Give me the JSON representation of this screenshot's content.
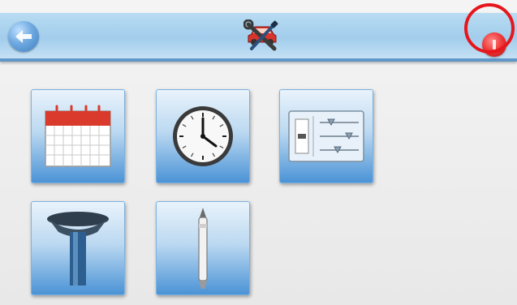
{
  "header": {
    "back_icon": "back-arrow-icon",
    "center_icon": "car-wrench-settings-icon",
    "exit_icon": "power-exit-icon",
    "exit_highlighted": true
  },
  "tiles": [
    {
      "id": "date",
      "icon": "calendar-icon"
    },
    {
      "id": "time",
      "icon": "clock-icon"
    },
    {
      "id": "adjustments",
      "icon": "sliders-icon"
    },
    {
      "id": "gps-antenna",
      "icon": "antenna-mount-icon"
    },
    {
      "id": "stylus",
      "icon": "stylus-pen-icon"
    }
  ],
  "colors": {
    "header_gradient_top": "#b8dcf2",
    "header_border": "#5f97c9",
    "tile_gradient_bottom": "#4b93d6",
    "highlight_ring": "#e5171c"
  }
}
